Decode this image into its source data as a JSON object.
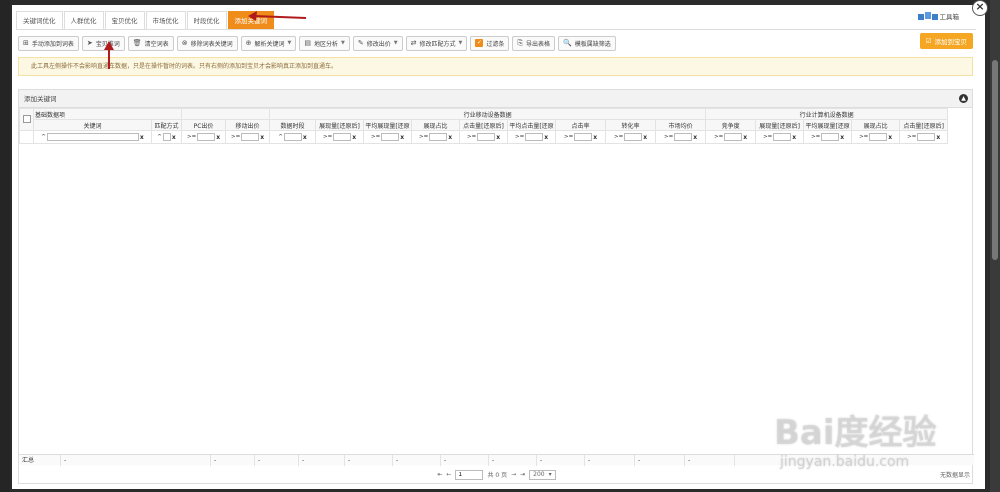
{
  "tabs": [
    "关键词优化",
    "人群优化",
    "宝贝优化",
    "市场优化",
    "时段优化",
    "添加关键词"
  ],
  "active_tab": 5,
  "brand": {
    "name": "工具箱"
  },
  "toolbar": [
    {
      "icon": "plus-icon",
      "glyph": "⊞",
      "label": "手动添加到词表"
    },
    {
      "icon": "send-icon",
      "glyph": "➤",
      "label": "宝贝推词"
    },
    {
      "icon": "trash-icon",
      "glyph": "🗑",
      "label": "清空词表"
    },
    {
      "icon": "remove-icon",
      "glyph": "⊗",
      "label": "移除词表关键词"
    },
    {
      "icon": "split-icon",
      "glyph": "⊕",
      "label": "解析关键词",
      "dropdown": true
    },
    {
      "icon": "map-icon",
      "glyph": "▤",
      "label": "地区分析",
      "dropdown": true
    },
    {
      "icon": "edit-icon",
      "glyph": "✎",
      "label": "修改出价",
      "dropdown": true
    },
    {
      "icon": "swap-icon",
      "glyph": "⇄",
      "label": "修改匹配方式",
      "dropdown": true
    },
    {
      "icon": "filter-check-icon",
      "glyph": "✓",
      "label": "过滤条",
      "checked": true
    },
    {
      "icon": "export-icon",
      "glyph": "⎘",
      "label": "导出表格"
    },
    {
      "icon": "search-icon",
      "glyph": "🔍",
      "label": "模板属缺筛选"
    }
  ],
  "add_plan_button": "添加到宝贝",
  "notice": "此工具左侧操作不会影响直通车数据，只是在操作暂时的词表。只有右侧的添加到宝贝才会影响真正添加到直通车。",
  "panel": {
    "title": "添加关键词"
  },
  "table": {
    "groups": [
      {
        "label": "基础数据项",
        "span": 3
      },
      {
        "label": "",
        "span": 2
      },
      {
        "label": "行业移动设备数据",
        "span": 9
      },
      {
        "label": "行业计算机设备数据",
        "span": 5
      }
    ],
    "columns": [
      "关键词",
      "匹配方式",
      "PC出价",
      "移动出价",
      "数据时段",
      "展现量[还原后]",
      "平均展现量[还原",
      "展现占比",
      "点击量[还原后]",
      "平均点击量[还原",
      "点击率",
      "转化率",
      "市场均价",
      "竞争度",
      "展现量[还原后]",
      "平均展现量[还原",
      "展现占比",
      "点击量[还原后]"
    ],
    "filter_ops": [
      "^",
      "^",
      ">=",
      ">=",
      "^",
      ">=",
      ">=",
      ">=",
      ">=",
      ">=",
      ">=",
      ">=",
      ">=",
      ">=",
      ">=",
      ">=",
      ">=",
      ">="
    ],
    "filter_clear": "x"
  },
  "summary": {
    "label": "汇总",
    "placeholders": [
      "-",
      "-",
      "-",
      "-",
      "-",
      "-",
      "-",
      "-",
      "-",
      "-",
      "-",
      "-"
    ]
  },
  "pager": {
    "page": "1",
    "total": "共 0 页",
    "page_size": "200",
    "nodata": "无数据显示"
  },
  "watermark": {
    "main": "Bai度经验",
    "sub": "jingyan.baidu.com"
  },
  "colors": {
    "accent": "#f08c19",
    "arrow": "#b01c1c",
    "notice_bg": "#fdf8e4"
  }
}
